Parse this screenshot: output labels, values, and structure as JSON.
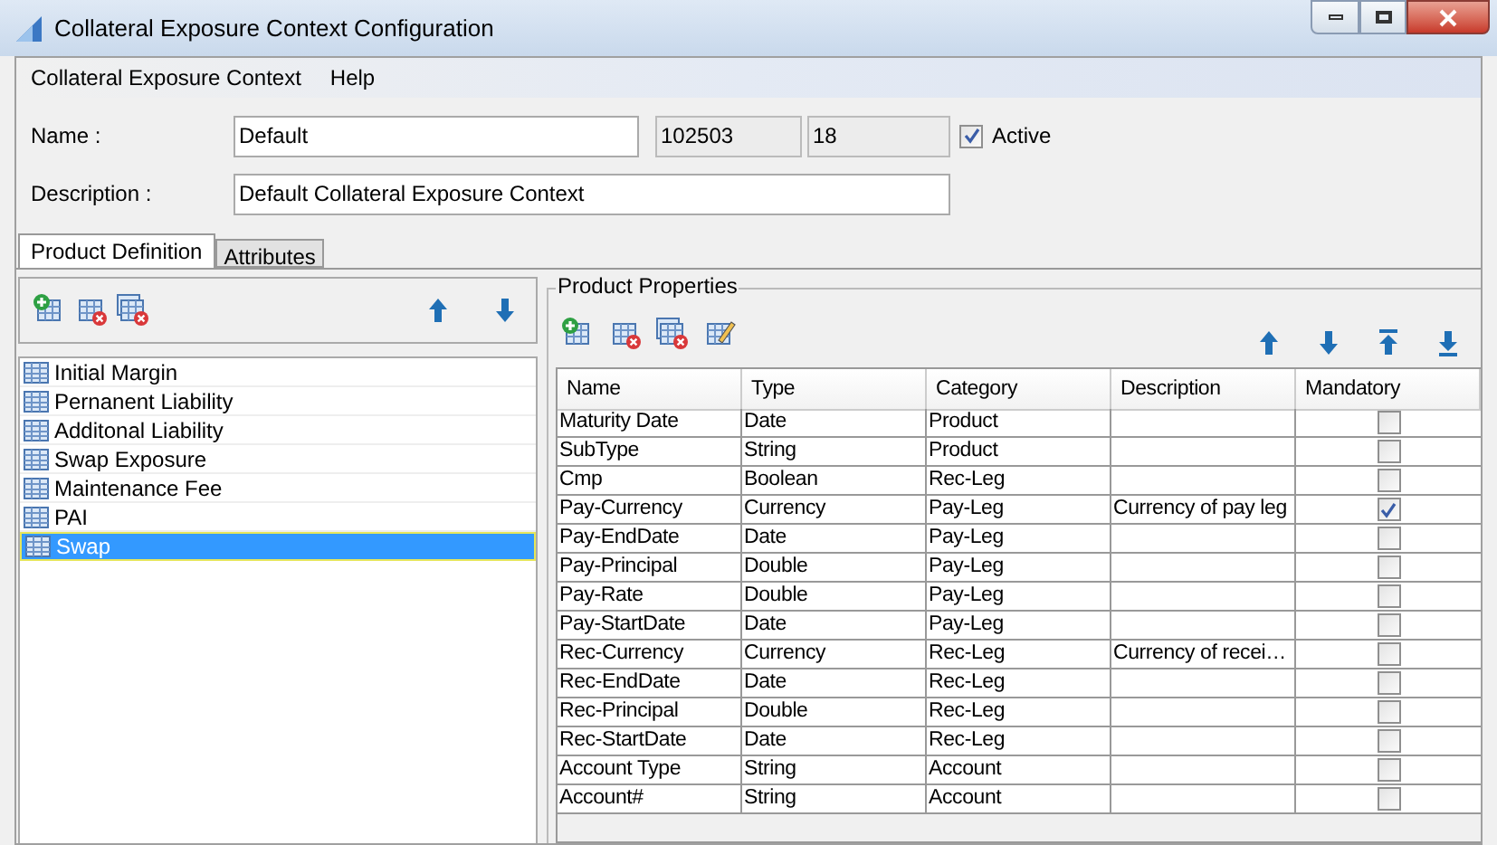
{
  "window": {
    "title": "Collateral Exposure Context Configuration"
  },
  "menu": [
    "Collateral Exposure Context",
    "Help"
  ],
  "form": {
    "name_label": "Name :",
    "name_value": "Default",
    "id_value": "102503",
    "version_value": "18",
    "active_label": "Active",
    "active_checked": true,
    "description_label": "Description :",
    "description_value": "Default Collateral Exposure Context"
  },
  "tabs": [
    {
      "label": "Product Definition",
      "selected": true
    },
    {
      "label": "Attributes",
      "selected": false
    }
  ],
  "products": [
    {
      "label": "Initial Margin",
      "selected": false
    },
    {
      "label": "Pernanent Liability",
      "selected": false
    },
    {
      "label": "Additonal Liability",
      "selected": false
    },
    {
      "label": "Swap Exposure",
      "selected": false
    },
    {
      "label": "Maintenance Fee",
      "selected": false
    },
    {
      "label": "PAI",
      "selected": false
    },
    {
      "label": "Swap",
      "selected": true
    }
  ],
  "properties": {
    "title": "Product Properties",
    "columns": [
      "Name",
      "Type",
      "Category",
      "Description",
      "Mandatory"
    ],
    "rows": [
      {
        "name": "Maturity Date",
        "type": "Date",
        "category": "Product",
        "description": "",
        "mandatory": false
      },
      {
        "name": "SubType",
        "type": "String",
        "category": "Product",
        "description": "",
        "mandatory": false
      },
      {
        "name": "Cmp",
        "type": "Boolean",
        "category": "Rec-Leg",
        "description": "",
        "mandatory": false
      },
      {
        "name": "Pay-Currency",
        "type": "Currency",
        "category": "Pay-Leg",
        "description": "Currency of pay leg",
        "mandatory": true
      },
      {
        "name": "Pay-EndDate",
        "type": "Date",
        "category": "Pay-Leg",
        "description": "",
        "mandatory": false
      },
      {
        "name": "Pay-Principal",
        "type": "Double",
        "category": "Pay-Leg",
        "description": "",
        "mandatory": false
      },
      {
        "name": "Pay-Rate",
        "type": "Double",
        "category": "Pay-Leg",
        "description": "",
        "mandatory": false
      },
      {
        "name": "Pay-StartDate",
        "type": "Date",
        "category": "Pay-Leg",
        "description": "",
        "mandatory": false
      },
      {
        "name": "Rec-Currency",
        "type": "Currency",
        "category": "Rec-Leg",
        "description": "Currency of recei…",
        "mandatory": false
      },
      {
        "name": "Rec-EndDate",
        "type": "Date",
        "category": "Rec-Leg",
        "description": "",
        "mandatory": false
      },
      {
        "name": "Rec-Principal",
        "type": "Double",
        "category": "Rec-Leg",
        "description": "",
        "mandatory": false
      },
      {
        "name": "Rec-StartDate",
        "type": "Date",
        "category": "Rec-Leg",
        "description": "",
        "mandatory": false
      },
      {
        "name": "Account Type",
        "type": "String",
        "category": "Account",
        "description": "",
        "mandatory": false
      },
      {
        "name": "Account#",
        "type": "String",
        "category": "Account",
        "description": "",
        "mandatory": false
      }
    ]
  }
}
